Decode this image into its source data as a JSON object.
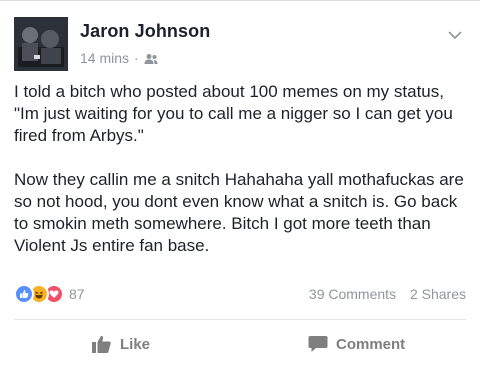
{
  "post": {
    "author": "Jaron Johnson",
    "time": "14 mins",
    "separator": "·",
    "privacy_icon": "friends-icon",
    "options_icon": "chevron-down-icon",
    "paragraphs": [
      "I told a bitch who posted about 100 memes on my status, \"Im just waiting for you to call me a nigger so I can get you fired from Arbys.\"",
      "Now they callin me a snitch Hahahaha yall mothafuckas are so not hood, you dont even know what a snitch is. Go back to smokin meth somewhere. Bitch I got more teeth than Violent Js entire fan base."
    ]
  },
  "stats": {
    "reaction_icons": [
      "like-reaction-icon",
      "haha-reaction-icon",
      "love-reaction-icon"
    ],
    "reaction_count": "87",
    "comments": "39 Comments",
    "shares": "2 Shares"
  },
  "actions": {
    "like_label": "Like",
    "comment_label": "Comment"
  },
  "colors": {
    "like_blue": "#5890ff",
    "haha_yellow": "#f7b125",
    "love_red": "#f25268",
    "text_dark": "#1d2129",
    "text_gray": "#90949c"
  }
}
